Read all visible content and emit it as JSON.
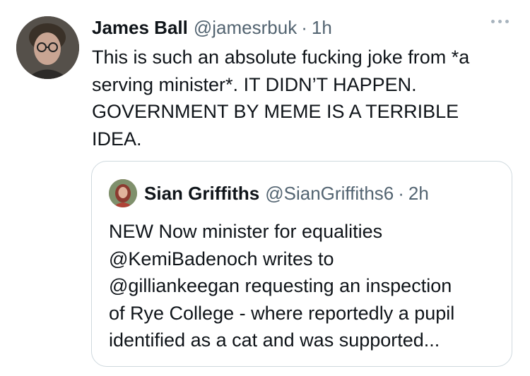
{
  "tweet": {
    "author_name": "James Ball",
    "author_handle": "@jamesrbuk",
    "separator": "·",
    "time": "1h",
    "text": "This is such an absolute fucking joke from *a\nserving minister*. IT DIDN’T HAPPEN.\nGOVERNMENT BY MEME IS A TERRIBLE\nIDEA."
  },
  "quoted_tweet": {
    "author_name": "Sian Griffiths",
    "author_handle": "@SianGriffiths6",
    "separator": "·",
    "time": "2h",
    "text": "NEW Now minister for equalities\n@KemiBadenoch writes to\n@gilliankeegan requesting an inspection\nof Rye College - where reportedly a pupil\nidentified as a cat and was supported..."
  },
  "icons": {
    "more": "more-options-icon"
  },
  "colors": {
    "text_primary": "#0f1419",
    "text_secondary": "#536471",
    "border": "#cfd9de",
    "more_dots": "#a7b3bd"
  }
}
